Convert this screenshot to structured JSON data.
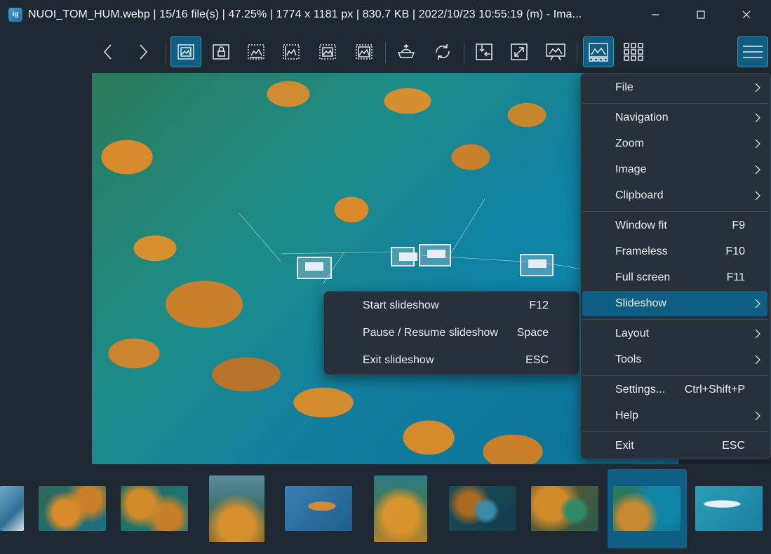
{
  "window": {
    "app_icon_text": "ig",
    "title": "NUOI_TOM_HUM.webp  |  15/16 file(s)  |  47.25%  |  1774 x 1181 px  |  830.7 KB  |  2022/10/23 10:55:19 (m)  - Ima..."
  },
  "toolbar": {
    "buttons": [
      {
        "name": "previous",
        "icon": "chevron-left-icon"
      },
      {
        "name": "next",
        "icon": "chevron-right-icon"
      },
      {
        "name": "auto-zoom",
        "icon": "image-fit-icon",
        "active": true
      },
      {
        "name": "lock-zoom",
        "icon": "image-lock-icon"
      },
      {
        "name": "scale-to-width",
        "icon": "image-width-icon"
      },
      {
        "name": "scale-to-height",
        "icon": "image-height-icon"
      },
      {
        "name": "scale-to-fit",
        "icon": "image-fit-dashed-icon"
      },
      {
        "name": "scale-to-fill",
        "icon": "image-fill-icon"
      },
      {
        "name": "checkerboard",
        "icon": "transparency-icon"
      },
      {
        "name": "rotate",
        "icon": "rotate-icon"
      },
      {
        "name": "open-with",
        "icon": "open-with-icon"
      },
      {
        "name": "fullscreen",
        "icon": "expand-icon"
      },
      {
        "name": "slideshow",
        "icon": "presentation-icon"
      },
      {
        "name": "thumbnail-bar",
        "icon": "thumbnail-bar-icon",
        "active": true
      },
      {
        "name": "gallery",
        "icon": "grid-icon"
      }
    ],
    "menu_button": "hamburger-icon"
  },
  "main_menu": {
    "items": [
      {
        "label": "File",
        "submenu": true
      },
      {
        "label": "Navigation",
        "submenu": true
      },
      {
        "label": "Zoom",
        "submenu": true
      },
      {
        "label": "Image",
        "submenu": true
      },
      {
        "label": "Clipboard",
        "submenu": true
      },
      {
        "label": "Window fit",
        "shortcut": "F9"
      },
      {
        "label": "Frameless",
        "shortcut": "F10"
      },
      {
        "label": "Full screen",
        "shortcut": "F11"
      },
      {
        "label": "Slideshow",
        "submenu": true,
        "highlighted": true
      },
      {
        "label": "Layout",
        "submenu": true
      },
      {
        "label": "Tools",
        "submenu": true
      },
      {
        "label": "Settings...",
        "shortcut": "Ctrl+Shift+P"
      },
      {
        "label": "Help",
        "submenu": true
      },
      {
        "label": "Exit",
        "shortcut": "ESC"
      }
    ]
  },
  "slideshow_submenu": {
    "items": [
      {
        "label": "Start slideshow",
        "shortcut": "F12"
      },
      {
        "label": "Pause / Resume slideshow",
        "shortcut": "Space"
      },
      {
        "label": "Exit slideshow",
        "shortcut": "ESC"
      }
    ]
  },
  "colors": {
    "background": "#1f2933",
    "menu_bg": "#27313b",
    "accent": "#0f5f85"
  }
}
